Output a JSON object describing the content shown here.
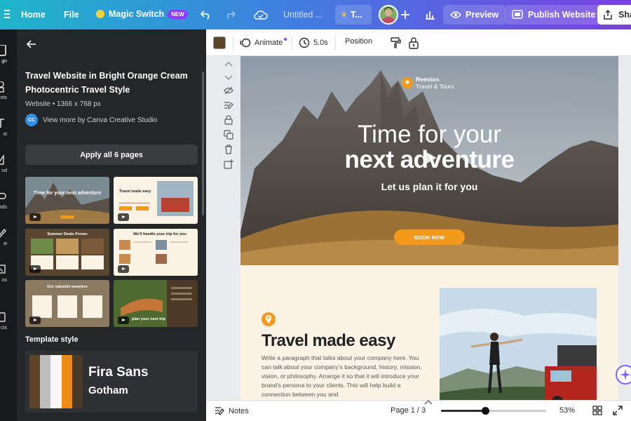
{
  "topbar": {
    "home": "Home",
    "file": "File",
    "magic_switch": "Magic Switch",
    "new_badge": "NEW",
    "doc_title": "Untitled ...",
    "brand_label": "T...",
    "preview": "Preview",
    "publish": "Publish Website",
    "share": "Sha"
  },
  "rail": [
    "gn",
    "nts",
    "xt",
    "nd",
    "ads",
    "w",
    "os",
    "cts"
  ],
  "panel": {
    "title": "Travel Website in Bright Orange Cream Photocentric Travel Style",
    "meta": "Website • 1366 x 768 px",
    "creator_badge": "CC",
    "creator": "View more by Canva Creative Studio",
    "apply": "Apply all 6 pages",
    "template_style": "Template style",
    "fonts": [
      "Fira Sans",
      "Gotham"
    ],
    "palette": [
      "#5b4429",
      "#bdbdbd",
      "#f7f7f7",
      "#f08a17",
      "#4a3a26"
    ],
    "thumbs": [
      {
        "caption": "Time for your next adventure"
      },
      {
        "caption": "Travel made easy"
      },
      {
        "caption": "Summer Deals Promo"
      },
      {
        "caption": "We'll handle your trip for you"
      },
      {
        "caption": "Our valuable travelers"
      },
      {
        "caption": "plan your next trip"
      }
    ]
  },
  "toolbar": {
    "animate": "Animate",
    "duration": "5.0s",
    "position": "Position",
    "color": "#5b4429"
  },
  "canvas": {
    "logo_name": "Reeston",
    "logo_sub": "Travel & Tours",
    "headline1": "Time for your",
    "headline2": "next adventure",
    "subhead": "Let us plan it for you",
    "cta": "BOOK NOW",
    "section_title": "Travel made easy",
    "paragraph": "Write a paragraph that talks about your company here. You can talk about your company's background, history, mission, vision, or philosophy. Arrange it so that it will introduce your brand's persona to your clients. This will help build a connection between you and",
    "accent": "#f39a1c"
  },
  "bottombar": {
    "notes": "Notes",
    "page": "Page 1 / 3",
    "zoom": "53%",
    "zoom_level": 0.42
  }
}
